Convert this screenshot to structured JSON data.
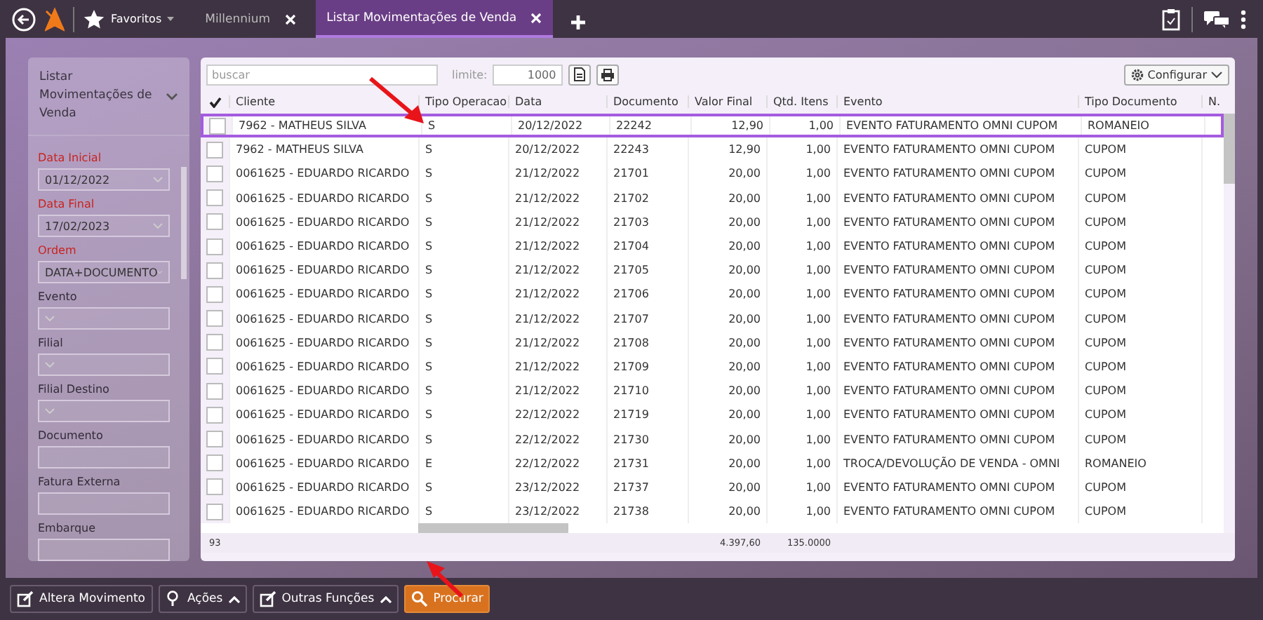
{
  "topbar": {
    "favorites": {
      "label": "Favoritos"
    },
    "tabs": [
      {
        "label": "Millennium",
        "selected": false
      },
      {
        "label": "Listar Movimentações de Venda",
        "selected": true
      }
    ]
  },
  "sidebar": {
    "title": "Listar Movimentações de Venda",
    "fields": [
      {
        "label": "Data Inicial",
        "required": true,
        "kind": "select",
        "value": "01/12/2022"
      },
      {
        "label": "Data Final",
        "required": true,
        "kind": "select",
        "value": "17/02/2023"
      },
      {
        "label": "Ordem",
        "required": true,
        "kind": "select",
        "value": "DATA+DOCUMENTO"
      },
      {
        "label": "Evento",
        "required": false,
        "kind": "select"
      },
      {
        "label": "Filial",
        "required": false,
        "kind": "select"
      },
      {
        "label": "Filial Destino",
        "required": false,
        "kind": "select"
      },
      {
        "label": "Documento",
        "required": false,
        "kind": "input"
      },
      {
        "label": "Fatura Externa",
        "required": false,
        "kind": "input"
      },
      {
        "label": "Embarque",
        "required": false,
        "kind": "input"
      }
    ]
  },
  "toolbar": {
    "search": {
      "placeholder": "buscar"
    },
    "limit": {
      "label": "limite:",
      "value": "1000"
    },
    "configure": {
      "label": "Configurar"
    }
  },
  "table": {
    "columns": [
      {
        "label": "Cliente",
        "kind": "text"
      },
      {
        "label": "Tipo Operacao",
        "kind": "text"
      },
      {
        "label": "Data",
        "kind": "text"
      },
      {
        "label": "Documento",
        "kind": "text"
      },
      {
        "label": "Valor Final",
        "kind": "number",
        "total": "4.397,60"
      },
      {
        "label": "Qtd. Itens",
        "kind": "number",
        "total": "135.0000"
      },
      {
        "label": "Evento",
        "kind": "text"
      },
      {
        "label": "Tipo Documento",
        "kind": "text"
      },
      {
        "label": "N.",
        "kind": "text"
      }
    ],
    "rows": [
      {
        "selected": true,
        "checked": false,
        "cells": [
          "7962 - MATHEUS SILVA",
          "S",
          "20/12/2022",
          "22242",
          "12,90",
          "1,00",
          "EVENTO FATURAMENTO OMNI CUPOM",
          "ROMANEIO"
        ]
      },
      {
        "selected": false,
        "checked": false,
        "cells": [
          "7962 - MATHEUS SILVA",
          "S",
          "20/12/2022",
          "22243",
          "12,90",
          "1,00",
          "EVENTO FATURAMENTO OMNI CUPOM",
          "CUPOM"
        ]
      },
      {
        "selected": false,
        "checked": false,
        "cells": [
          "0061625 - EDUARDO RICARDO",
          "S",
          "21/12/2022",
          "21701",
          "20,00",
          "1,00",
          "EVENTO FATURAMENTO OMNI CUPOM",
          "CUPOM"
        ]
      },
      {
        "selected": false,
        "checked": false,
        "cells": [
          "0061625 - EDUARDO RICARDO",
          "S",
          "21/12/2022",
          "21702",
          "20,00",
          "1,00",
          "EVENTO FATURAMENTO OMNI CUPOM",
          "CUPOM"
        ]
      },
      {
        "selected": false,
        "checked": false,
        "cells": [
          "0061625 - EDUARDO RICARDO",
          "S",
          "21/12/2022",
          "21703",
          "20,00",
          "1,00",
          "EVENTO FATURAMENTO OMNI CUPOM",
          "CUPOM"
        ]
      },
      {
        "selected": false,
        "checked": false,
        "cells": [
          "0061625 - EDUARDO RICARDO",
          "S",
          "21/12/2022",
          "21704",
          "20,00",
          "1,00",
          "EVENTO FATURAMENTO OMNI CUPOM",
          "CUPOM"
        ]
      },
      {
        "selected": false,
        "checked": false,
        "cells": [
          "0061625 - EDUARDO RICARDO",
          "S",
          "21/12/2022",
          "21705",
          "20,00",
          "1,00",
          "EVENTO FATURAMENTO OMNI CUPOM",
          "CUPOM"
        ]
      },
      {
        "selected": false,
        "checked": false,
        "cells": [
          "0061625 - EDUARDO RICARDO",
          "S",
          "21/12/2022",
          "21706",
          "20,00",
          "1,00",
          "EVENTO FATURAMENTO OMNI CUPOM",
          "CUPOM"
        ]
      },
      {
        "selected": false,
        "checked": false,
        "cells": [
          "0061625 - EDUARDO RICARDO",
          "S",
          "21/12/2022",
          "21707",
          "20,00",
          "1,00",
          "EVENTO FATURAMENTO OMNI CUPOM",
          "CUPOM"
        ]
      },
      {
        "selected": false,
        "checked": false,
        "cells": [
          "0061625 - EDUARDO RICARDO",
          "S",
          "21/12/2022",
          "21708",
          "20,00",
          "1,00",
          "EVENTO FATURAMENTO OMNI CUPOM",
          "CUPOM"
        ]
      },
      {
        "selected": false,
        "checked": false,
        "cells": [
          "0061625 - EDUARDO RICARDO",
          "S",
          "21/12/2022",
          "21709",
          "20,00",
          "1,00",
          "EVENTO FATURAMENTO OMNI CUPOM",
          "CUPOM"
        ]
      },
      {
        "selected": false,
        "checked": false,
        "cells": [
          "0061625 - EDUARDO RICARDO",
          "S",
          "21/12/2022",
          "21710",
          "20,00",
          "1,00",
          "EVENTO FATURAMENTO OMNI CUPOM",
          "CUPOM"
        ]
      },
      {
        "selected": false,
        "checked": false,
        "cells": [
          "0061625 - EDUARDO RICARDO",
          "S",
          "22/12/2022",
          "21719",
          "20,00",
          "1,00",
          "EVENTO FATURAMENTO OMNI CUPOM",
          "CUPOM"
        ]
      },
      {
        "selected": false,
        "checked": false,
        "cells": [
          "0061625 - EDUARDO RICARDO",
          "S",
          "22/12/2022",
          "21730",
          "20,00",
          "1,00",
          "EVENTO FATURAMENTO OMNI CUPOM",
          "CUPOM"
        ]
      },
      {
        "selected": false,
        "checked": false,
        "cells": [
          "0061625 - EDUARDO RICARDO",
          "E",
          "22/12/2022",
          "21731",
          "20,00",
          "1,00",
          "TROCA/DEVOLUÇÃO DE VENDA - OMNI",
          "ROMANEIO"
        ]
      },
      {
        "selected": false,
        "checked": false,
        "cells": [
          "0061625 - EDUARDO RICARDO",
          "S",
          "23/12/2022",
          "21737",
          "20,00",
          "1,00",
          "EVENTO FATURAMENTO OMNI CUPOM",
          "CUPOM"
        ]
      },
      {
        "selected": false,
        "checked": false,
        "cells": [
          "0061625 - EDUARDO RICARDO",
          "S",
          "23/12/2022",
          "21738",
          "20,00",
          "1,00",
          "EVENTO FATURAMENTO OMNI CUPOM",
          "CUPOM"
        ]
      }
    ],
    "footer": {
      "count": "93"
    }
  },
  "actions": [
    {
      "label": "Altera Movimento",
      "dropdown": false,
      "primary": false
    },
    {
      "label": "Ações",
      "dropdown": true,
      "primary": false
    },
    {
      "label": "Outras Funções",
      "dropdown": true,
      "primary": false
    },
    {
      "label": "Procurar",
      "dropdown": false,
      "primary": true
    }
  ]
}
